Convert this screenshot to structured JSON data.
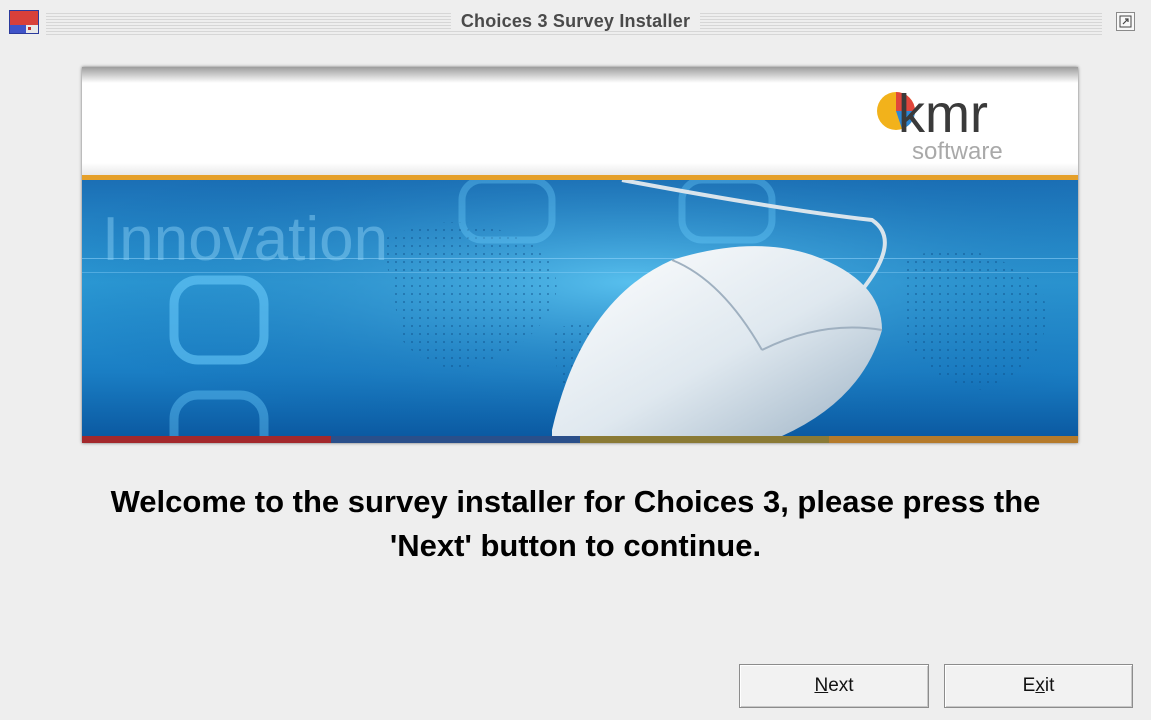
{
  "window": {
    "title": "Choices 3 Survey Installer"
  },
  "banner": {
    "logo_main": "kmr",
    "logo_sub": "software",
    "watermark_text": "Innovation"
  },
  "message": {
    "line1": "Welcome to the survey installer for Choices 3, please press the",
    "line2": "'Next' button to continue."
  },
  "buttons": {
    "next": {
      "mnemonic": "N",
      "rest": "ext"
    },
    "exit": {
      "pre": "E",
      "mnemonic": "x",
      "rest": "it"
    }
  },
  "colors": {
    "background": "#eeeeee",
    "accent_orange": "#e5a02a",
    "banner_blue": "#2c9bd6"
  },
  "icons": {
    "app": "java-app-icon",
    "maximize": "maximize-icon",
    "mouse": "computer-mouse-image"
  }
}
